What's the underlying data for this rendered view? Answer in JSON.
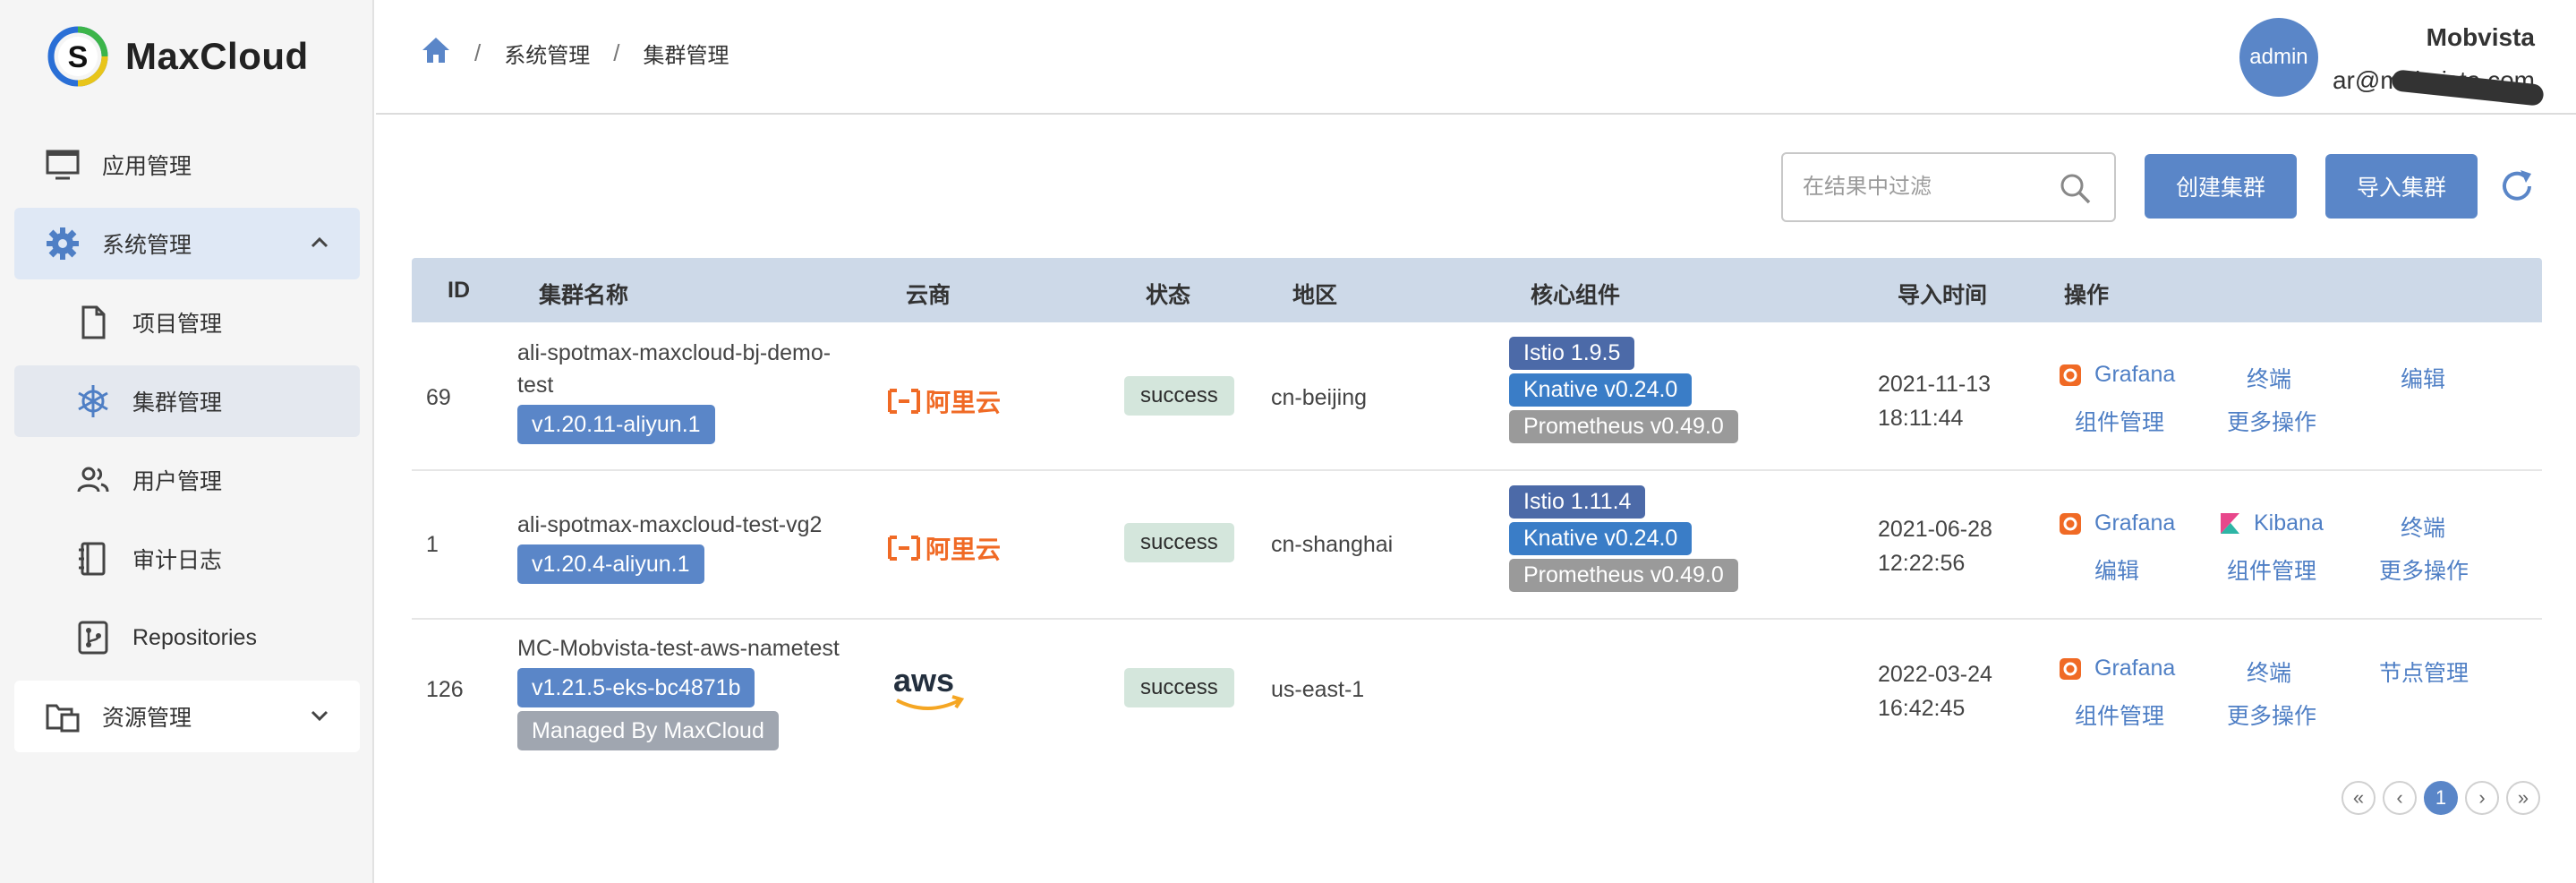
{
  "brand": {
    "name": "MaxCloud",
    "logo_letter": "S"
  },
  "sidebar": {
    "items": [
      {
        "label": "应用管理",
        "icon": "monitor-icon"
      },
      {
        "label": "系统管理",
        "icon": "gear-icon"
      },
      {
        "label": "项目管理",
        "icon": "document-icon"
      },
      {
        "label": "集群管理",
        "icon": "helm-icon"
      },
      {
        "label": "用户管理",
        "icon": "users-icon"
      },
      {
        "label": "审计日志",
        "icon": "log-book-icon"
      },
      {
        "label": "Repositories",
        "icon": "repo-icon"
      },
      {
        "label": "资源管理",
        "icon": "folders-icon"
      }
    ]
  },
  "header": {
    "breadcrumb": [
      "系统管理",
      "集群管理"
    ],
    "user": {
      "avatar_label": "admin",
      "name": "Mobvista",
      "email": "ar@mobvista.com"
    }
  },
  "toolbar": {
    "search_placeholder": "在结果中过滤",
    "create_label": "创建集群",
    "import_label": "导入集群"
  },
  "table": {
    "columns": [
      "ID",
      "集群名称",
      "云商",
      "状态",
      "地区",
      "核心组件",
      "导入时间",
      "操作"
    ],
    "rows": [
      {
        "id": "69",
        "name_line1": "ali-spotmax-maxcloud-bj-demo-",
        "name_line2": "test",
        "version": "v1.20.11-aliyun.1",
        "provider": "阿里云",
        "status": "success",
        "region": "cn-beijing",
        "components": [
          "Istio 1.9.5",
          "Knative v0.24.0",
          "Prometheus v0.49.0"
        ],
        "import_date": "2021-11-13",
        "import_time": "18:11:44",
        "actions": [
          "Grafana",
          "终端",
          "编辑",
          "组件管理",
          "更多操作"
        ]
      },
      {
        "id": "1",
        "name_line1": "ali-spotmax-maxcloud-test-vg2",
        "version": "v1.20.4-aliyun.1",
        "provider": "阿里云",
        "status": "success",
        "region": "cn-shanghai",
        "components": [
          "Istio 1.11.4",
          "Knative v0.24.0",
          "Prometheus v0.49.0"
        ],
        "import_date": "2021-06-28",
        "import_time": "12:22:56",
        "actions": [
          "Grafana",
          "Kibana",
          "终端",
          "编辑",
          "组件管理",
          "更多操作"
        ]
      },
      {
        "id": "126",
        "name_line1": "MC-Mobvista-test-aws-nametest",
        "version": "v1.21.5-eks-bc4871b",
        "managed": "Managed By MaxCloud",
        "provider": "aws",
        "status": "success",
        "region": "us-east-1",
        "import_date": "2022-03-24",
        "import_time": "16:42:45",
        "actions": [
          "Grafana",
          "终端",
          "节点管理",
          "组件管理",
          "更多操作"
        ]
      }
    ]
  },
  "pagination": {
    "first": "«",
    "prev": "‹",
    "current": "1",
    "next": "›",
    "last": "»"
  },
  "colors": {
    "accent": "#5a86c8",
    "aliyun": "#f06a25",
    "header_bg": "#cdd9e8",
    "success_bg": "#d4e6dc"
  }
}
